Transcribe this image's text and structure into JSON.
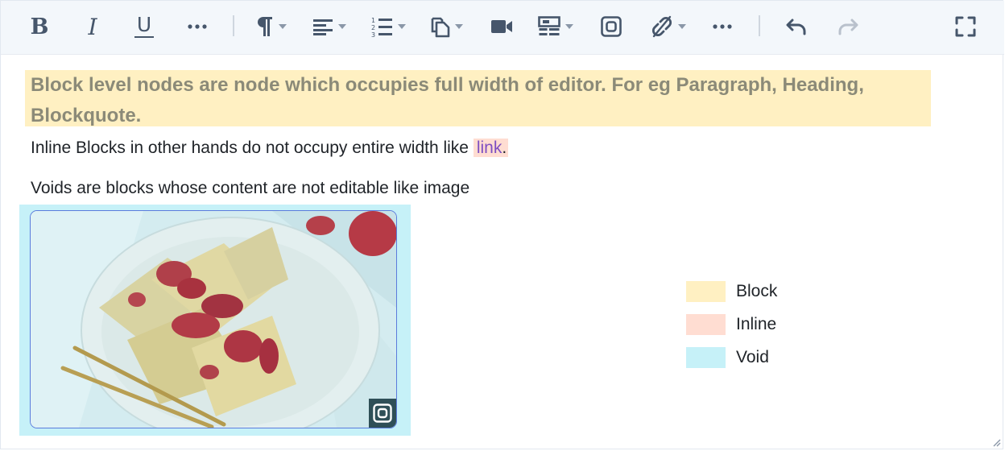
{
  "toolbar": {
    "buttons": [
      {
        "name": "bold",
        "glyph": "B"
      },
      {
        "name": "italic",
        "glyph": "I"
      },
      {
        "name": "underline",
        "glyph": "U"
      }
    ]
  },
  "content": {
    "block_text": "Block level nodes are node which occupies full width of editor. For eg Paragraph, Heading, Blockquote.",
    "inline_prefix": "Inline Blocks in other hands do not occupy entire width like ",
    "inline_link": "link",
    "inline_suffix": ".",
    "void_text": "Voids are blocks whose content are not editable like image"
  },
  "legend": {
    "items": [
      {
        "label": "Block",
        "color": "#fff0c2"
      },
      {
        "label": "Inline",
        "color": "#ffddd2"
      },
      {
        "label": "Void",
        "color": "#c6f1f8"
      }
    ]
  },
  "colors": {
    "toolbar_bg": "#f3f7fb",
    "icon": "#46566b",
    "block": "#fff0c2",
    "inline": "#ffddd2",
    "void": "#c6f1f8",
    "link": "#7e4fc2",
    "selection_border": "#5b7bdc"
  }
}
